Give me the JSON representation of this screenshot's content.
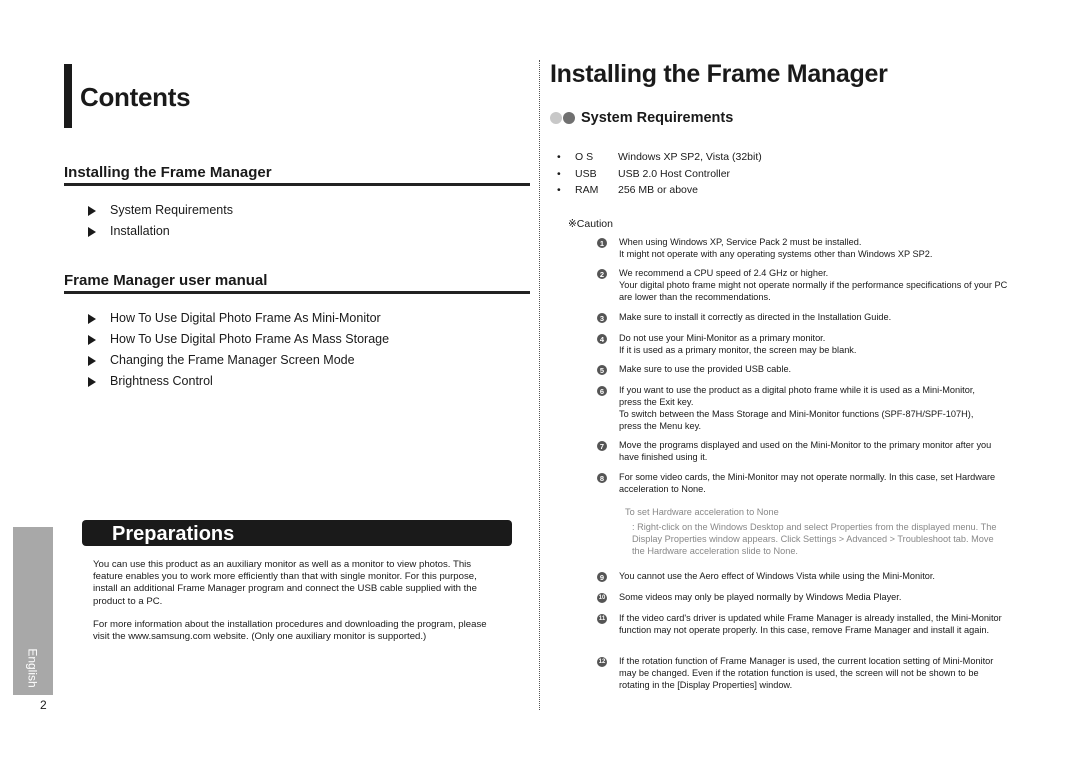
{
  "left_page": {
    "title": "Contents",
    "sections": [
      {
        "title": "Installing the Frame Manager",
        "items": [
          "System Requirements",
          "Installation"
        ]
      },
      {
        "title": "Frame Manager user manual",
        "items": [
          "How To Use Digital Photo Frame As Mini-Monitor",
          "How To Use Digital Photo Frame As Mass Storage",
          "Changing the Frame Manager Screen Mode",
          "Brightness Control"
        ]
      }
    ],
    "preparations": {
      "title": "Preparations",
      "paragraphs": [
        "You can use this product as an auxiliary monitor as well as a monitor to view photos. This feature enables you to work more efficiently than that with single monitor. For this purpose, install an additional Frame Manager program and connect the USB cable supplied with the product to a PC.",
        "For more information about the installation procedures and downloading the program, please visit the www.samsung.com website. (Only one auxiliary monitor is supported.)"
      ]
    },
    "language_tab": "English",
    "page_number": "2"
  },
  "right_page": {
    "title": "Installing the Frame Manager",
    "subsection_title": "System Requirements",
    "subsection_dot_colors": [
      "#c8c8c8",
      "#707070"
    ],
    "requirements": [
      {
        "bullet": "•",
        "key": "O S",
        "value": "Windows XP SP2, Vista (32bit)"
      },
      {
        "bullet": "•",
        "key": "USB",
        "value": "USB 2.0 Host Controller"
      },
      {
        "bullet": "•",
        "key": "RAM",
        "value": "256 MB or above"
      }
    ],
    "caution_label": "※Caution",
    "notes": [
      {
        "num": "1",
        "lines": [
          "When using Windows XP, Service Pack 2 must be installed.",
          "It might not operate with any operating systems other than Windows XP SP2."
        ]
      },
      {
        "num": "2",
        "lines": [
          "We recommend a CPU speed of 2.4 GHz or higher.",
          "Your digital photo frame might not operate normally if the performance specifications of your PC are lower than the recommendations."
        ]
      },
      {
        "num": "3",
        "lines": [
          "Make sure to install it correctly as directed in the Installation Guide."
        ]
      },
      {
        "num": "4",
        "lines": [
          "Do not use your Mini-Monitor as a primary monitor.",
          "If it is used as a primary monitor, the screen may be blank."
        ]
      },
      {
        "num": "5",
        "lines": [
          "Make sure to use the provided USB cable."
        ]
      },
      {
        "num": "6",
        "lines": [
          "If you want to use the product as a digital photo frame while it is used as a Mini-Monitor, press the Exit key.",
          "To switch between the Mass Storage and Mini-Monitor functions (SPF-87H/SPF-107H), press the Menu key."
        ]
      },
      {
        "num": "7",
        "lines": [
          "Move the programs displayed and used on the Mini-Monitor to the primary monitor after you have finished using it."
        ]
      },
      {
        "num": "8",
        "lines": [
          "For some video cards, the Mini-Monitor may not operate normally. In this case, set Hardware acceleration to None."
        ]
      },
      {
        "num": "9",
        "lines": [
          "You cannot use the Aero effect of Windows Vista while using the Mini-Monitor."
        ]
      },
      {
        "num": "10",
        "lines": [
          "Some videos may only be played normally by Windows Media Player."
        ]
      },
      {
        "num": "11",
        "lines": [
          "If the video card's driver is updated while Frame Manager is already installed, the Mini-Monitor function may not operate properly. In this case, remove Frame Manager and install it again."
        ]
      },
      {
        "num": "12",
        "lines": [
          "If the rotation function of Frame Manager is used, the current location setting of Mini-Monitor may be changed. Even if the rotation function is used, the screen will not be shown to be rotating in the [Display Properties] window."
        ]
      }
    ],
    "hardware_acceleration": {
      "title": "To set Hardware acceleration to None",
      "text": ": Right-click on the Windows Desktop and select Properties from the displayed menu. The Display Properties window appears. Click Settings > Advanced > Troubleshoot tab. Move the Hardware acceleration slide to None."
    }
  }
}
